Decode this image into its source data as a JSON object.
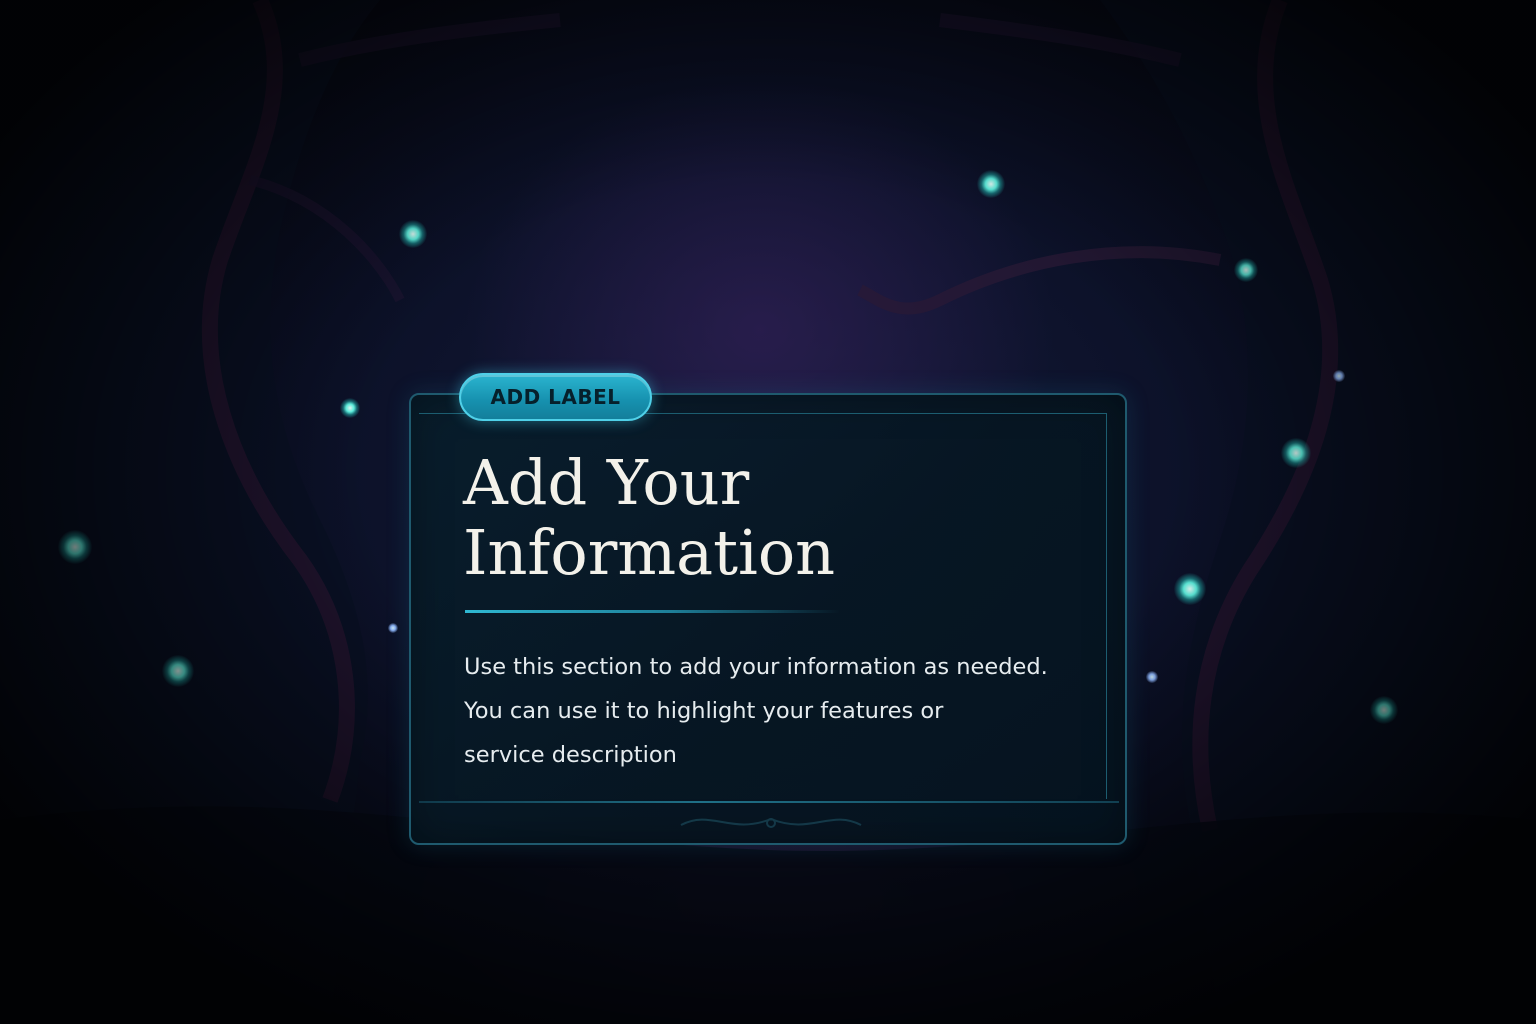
{
  "label": {
    "text": "ADD LABEL"
  },
  "title": {
    "line1": "Add Your",
    "line2": "Information"
  },
  "body": {
    "line1": "Use this section to add your information as needed.",
    "line2": "You can use it to highlight your features or",
    "line3": "service description"
  },
  "colors": {
    "accent": "#2ab4cf",
    "card_border": "#1f5a6e",
    "firefly": "#5ff3e2",
    "background": "#0b1026"
  }
}
